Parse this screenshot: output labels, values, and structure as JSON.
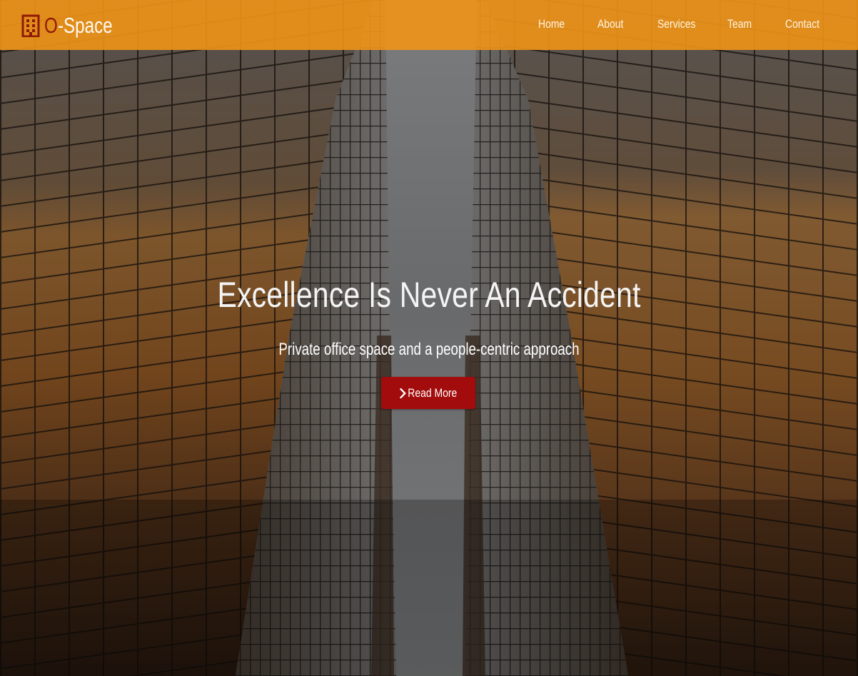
{
  "brand": {
    "icon": "building-icon",
    "name_prefix": "O",
    "name_rest": "-Space",
    "prefix_color": "#8f1a05"
  },
  "nav": {
    "items": [
      {
        "label": "Home"
      },
      {
        "label": "About"
      },
      {
        "label": "Services"
      },
      {
        "label": "Team"
      },
      {
        "label": "Contact"
      }
    ],
    "bar_color": "#ef9417"
  },
  "hero": {
    "title": "Excellence Is Never An Accident",
    "subtitle": "Private office space and a people-centric approach",
    "cta_label": "Read More",
    "cta_icon": "chevron-right-icon",
    "cta_color": "#a30c0c",
    "background": "skyscrapers-looking-up-photo"
  }
}
